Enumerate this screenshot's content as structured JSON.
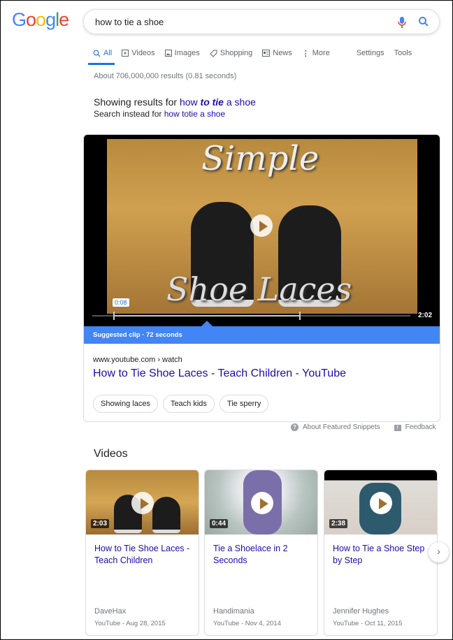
{
  "logo": {
    "text": "Google",
    "colors": [
      "#4285f4",
      "#ea4335",
      "#fbbc05",
      "#4285f4",
      "#34a853",
      "#ea4335"
    ]
  },
  "search": {
    "query": "how to tie a shoe"
  },
  "tabs": [
    {
      "label": "All",
      "icon": "search-icon"
    },
    {
      "label": "Videos",
      "icon": "video-icon"
    },
    {
      "label": "Images",
      "icon": "image-icon"
    },
    {
      "label": "Shopping",
      "icon": "tag-icon"
    },
    {
      "label": "News",
      "icon": "news-icon"
    },
    {
      "label": "More",
      "icon": "more-vert-icon"
    }
  ],
  "tools": {
    "settings": "Settings",
    "tools": "Tools"
  },
  "result_stats": "About 706,000,000 results (0.81 seconds)",
  "spelling": {
    "showing_prefix": "Showing results for",
    "showing_a": "how ",
    "showing_b": "to tie",
    "showing_c": " a shoe",
    "instead_prefix": "Search instead for",
    "instead_link": "how totie a shoe"
  },
  "featured": {
    "overlay_top": "Simple",
    "overlay_bottom": "Shoe Laces",
    "marker": "0:08",
    "duration": "2:02",
    "clip_label": "Suggested clip · 72 seconds",
    "url": "www.youtube.com › watch",
    "title": "How to Tie Shoe Laces - Teach Children - YouTube",
    "chips": [
      "Showing laces",
      "Teach kids",
      "Tie sperry"
    ]
  },
  "snippet_footer": {
    "about": "About Featured Snippets",
    "feedback": "Feedback"
  },
  "videos": {
    "heading": "Videos",
    "items": [
      {
        "duration": "2:03",
        "title": "How to Tie Shoe Laces - Teach Children",
        "channel": "DaveHax",
        "meta": "YouTube - Aug 28, 2015"
      },
      {
        "duration": "0:44",
        "title": "Tie a Shoelace in 2 Seconds",
        "channel": "Handimania",
        "meta": "YouTube - Nov 4, 2014"
      },
      {
        "duration": "2:38",
        "title": "How to Tie a Shoe Step by Step",
        "channel": "Jennifer Hughes",
        "meta": "YouTube - Oct 11, 2015"
      }
    ]
  }
}
